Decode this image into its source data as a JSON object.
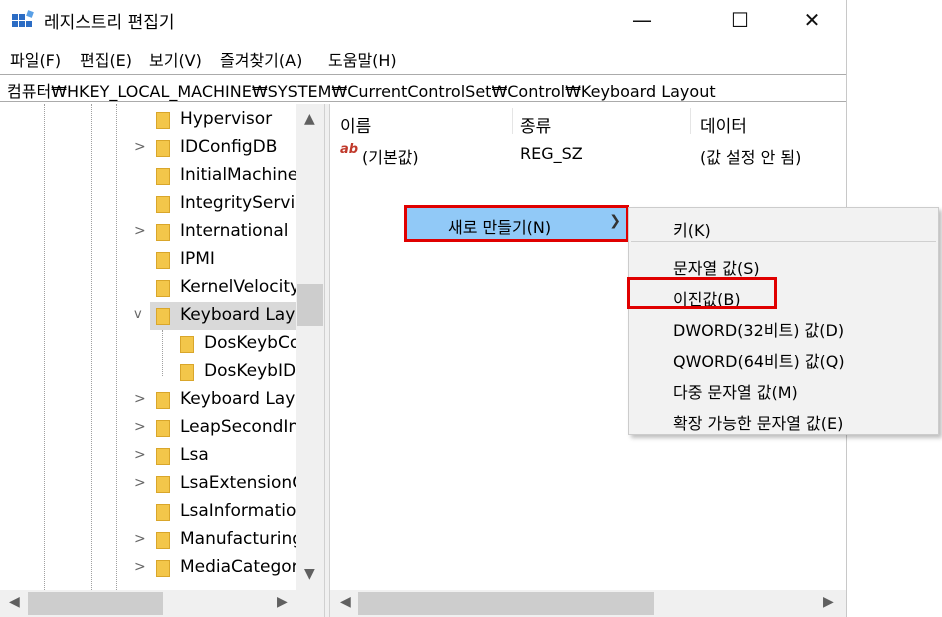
{
  "window": {
    "title": "레지스트리 편집기",
    "minimize": "—",
    "maximize": "☐",
    "close": "✕"
  },
  "menu": [
    "파일(F)",
    "편집(E)",
    "보기(V)",
    "즐겨찾기(A)",
    "도움말(H)"
  ],
  "address": "컴퓨터₩HKEY_LOCAL_MACHINE₩SYSTEM₩CurrentControlSet₩Control₩Keyboard Layout",
  "tree": [
    {
      "label": "Hypervisor",
      "expander": ""
    },
    {
      "label": "IDConfigDB",
      "expander": ">"
    },
    {
      "label": "InitialMachineC",
      "expander": ""
    },
    {
      "label": "IntegrityService",
      "expander": ""
    },
    {
      "label": "International",
      "expander": ">"
    },
    {
      "label": "IPMI",
      "expander": ""
    },
    {
      "label": "KernelVelocity",
      "expander": ""
    },
    {
      "label": "Keyboard Layo",
      "expander": "v",
      "selected": true
    },
    {
      "label": "DosKeybCo",
      "expander": "",
      "child": true
    },
    {
      "label": "DosKeybIDs",
      "expander": "",
      "child": true
    },
    {
      "label": "Keyboard Layo",
      "expander": ">"
    },
    {
      "label": "LeapSecondInf",
      "expander": ">"
    },
    {
      "label": "Lsa",
      "expander": ">"
    },
    {
      "label": "LsaExtensionCo",
      "expander": ">"
    },
    {
      "label": "LsaInformation",
      "expander": ""
    },
    {
      "label": "Manufacturing",
      "expander": ">"
    },
    {
      "label": "MediaCategori",
      "expander": ">"
    }
  ],
  "list": {
    "columns": [
      "이름",
      "종류",
      "데이터"
    ],
    "rows": [
      {
        "icon": "ab",
        "name": "(기본값)",
        "type": "REG_SZ",
        "data": "(값 설정 안 됨)"
      }
    ]
  },
  "context_menu": {
    "new_label": "새로 만들기(N)",
    "submenu": [
      "키(K)",
      "문자열 값(S)",
      "이진값(B)",
      "DWORD(32비트) 값(D)",
      "QWORD(64비트) 값(Q)",
      "다중 문자열 값(M)",
      "확장 가능한 문자열 값(E)"
    ]
  },
  "colors": {
    "menu_highlight": "#91c9f7",
    "annotation_red": "#e00000",
    "folder": "#f3c64a"
  }
}
